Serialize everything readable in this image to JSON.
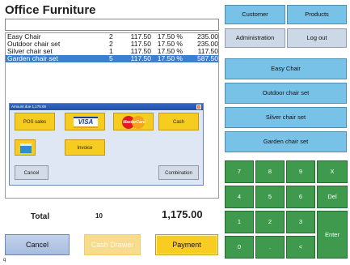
{
  "header": {
    "title": "Office Furniture"
  },
  "search": {
    "value": ""
  },
  "order_lines": [
    {
      "name": "Easy Chair",
      "qty": "2",
      "price": "117.50",
      "tax": "17.50 %",
      "total": "235.00"
    },
    {
      "name": "Outdoor chair set",
      "qty": "2",
      "price": "117.50",
      "tax": "17.50 %",
      "total": "235.00"
    },
    {
      "name": "Silver chair set",
      "qty": "1",
      "price": "117.50",
      "tax": "17.50 %",
      "total": "117.50"
    },
    {
      "name": "Garden chair set",
      "qty": "5",
      "price": "117.50",
      "tax": "17.50 %",
      "total": "587.50",
      "selected": true
    }
  ],
  "dialog": {
    "title": "Amount due 1,175.00",
    "pos_sales": "POS sales",
    "visa": "VISA",
    "mastercard": "MasterCard",
    "cash": "Cash",
    "invoice": "Invoice",
    "cancel": "Cancel",
    "combination": "Combination"
  },
  "totals": {
    "label": "Total",
    "qty": "10",
    "amount": "1,175.00"
  },
  "bottom_buttons": {
    "cancel": "Cancel",
    "cash_drawer": "Cash Drawer",
    "payment": "Payment"
  },
  "footer": {
    "text": "q"
  },
  "nav": {
    "customer": "Customer",
    "products": "Products",
    "administration": "Administration",
    "logout": "Log out"
  },
  "products": [
    "Easy Chair",
    "Outdoor chair set",
    "Silver chair set",
    "Garden chair set"
  ],
  "keypad": {
    "k7": "7",
    "k8": "8",
    "k9": "9",
    "kx": "X",
    "k4": "4",
    "k5": "5",
    "k6": "6",
    "kdel": "Del",
    "k1": "1",
    "k2": "2",
    "k3": "3",
    "kenter": "Enter",
    "k0": "0",
    "kdot": ".",
    "kless": "<"
  },
  "colors": {
    "product_button": "#78c2e8",
    "keypad": "#3f9a4d",
    "payment": "#f8cc22",
    "selected_row": "#3b7fd0"
  }
}
